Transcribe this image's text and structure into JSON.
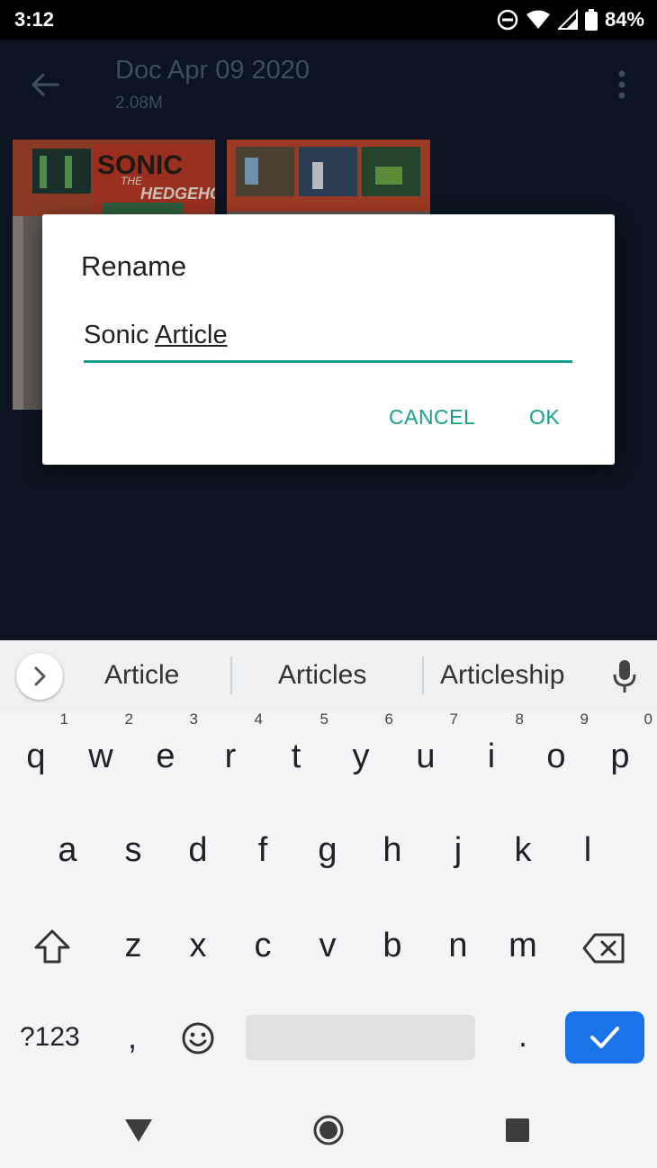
{
  "status_bar": {
    "time": "3:12",
    "battery": "84%"
  },
  "app_bar": {
    "title": "Doc Apr 09 2020",
    "subtitle": "2.08M"
  },
  "thumbnail_texts": {
    "logo_word1": "SONIC",
    "logo_word2": "THE",
    "logo_word3": "HEDGEHOG"
  },
  "dialog": {
    "title": "Rename",
    "value_word1": "Sonic",
    "value_word2": "Article",
    "cancel_label": "CANCEL",
    "ok_label": "OK"
  },
  "keyboard": {
    "suggestions": [
      "Article",
      "Articles",
      "Articleship"
    ],
    "row1": [
      "q",
      "w",
      "e",
      "r",
      "t",
      "y",
      "u",
      "i",
      "o",
      "p"
    ],
    "row1_hints": [
      "1",
      "2",
      "3",
      "4",
      "5",
      "6",
      "7",
      "8",
      "9",
      "0"
    ],
    "row2": [
      "a",
      "s",
      "d",
      "f",
      "g",
      "h",
      "j",
      "k",
      "l"
    ],
    "row3": [
      "z",
      "x",
      "c",
      "v",
      "b",
      "n",
      "m"
    ],
    "symbols_label": "?123",
    "comma": ",",
    "period": "."
  },
  "colors": {
    "accent": "#14a08a",
    "enter_key": "#1a73e8",
    "app_bg": "#0b1420"
  }
}
